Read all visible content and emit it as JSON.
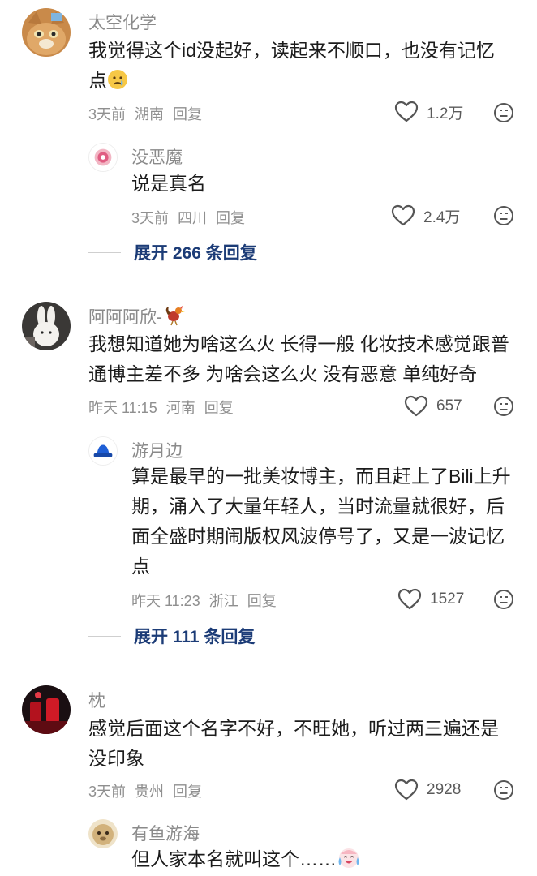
{
  "comments": [
    {
      "username": "太空化学",
      "text": "我觉得这个id没起好，读起来不顺口，也没有记忆点",
      "emoji": "crying-face",
      "time": "3天前",
      "location": "湖南",
      "reply_label": "回复",
      "likes": "1.2万",
      "replies": [
        {
          "username": "没恶魔",
          "text": "说是真名",
          "time": "3天前",
          "location": "四川",
          "reply_label": "回复",
          "likes": "2.4万"
        }
      ],
      "expand_label": "展开 266 条回复"
    },
    {
      "username": "阿阿阿欣-",
      "text": "我想知道她为啥这么火 长得一般 化妆技术感觉跟普通博主差不多 为啥会这么火 没有恶意 单纯好奇",
      "time": "昨天 11:15",
      "location": "河南",
      "reply_label": "回复",
      "likes": "657",
      "replies": [
        {
          "username": "游月边",
          "text": "算是最早的一批美妆博主，而且赶上了Bili上升期，涌入了大量年轻人，当时流量就很好，后面全盛时期闹版权风波停号了，又是一波记忆点",
          "time": "昨天 11:23",
          "location": "浙江",
          "reply_label": "回复",
          "likes": "1527"
        }
      ],
      "expand_label": "展开 111 条回复"
    },
    {
      "username": "枕",
      "text": "感觉后面这个名字不好，不旺她，听过两三遍还是没印象",
      "time": "3天前",
      "location": "贵州",
      "reply_label": "回复",
      "likes": "2928",
      "replies": [
        {
          "username": "有鱼游海",
          "text": "但人家本名就叫这个……",
          "emoji": "crying-laughing-face"
        }
      ]
    }
  ],
  "icons": {
    "like": "heart-outline-icon",
    "dislike": "neutral-face-icon"
  },
  "colors": {
    "username": "#8a8a8a",
    "meta": "#8f8f8f",
    "expand": "#1c3c77",
    "text": "#1c1c1c"
  }
}
